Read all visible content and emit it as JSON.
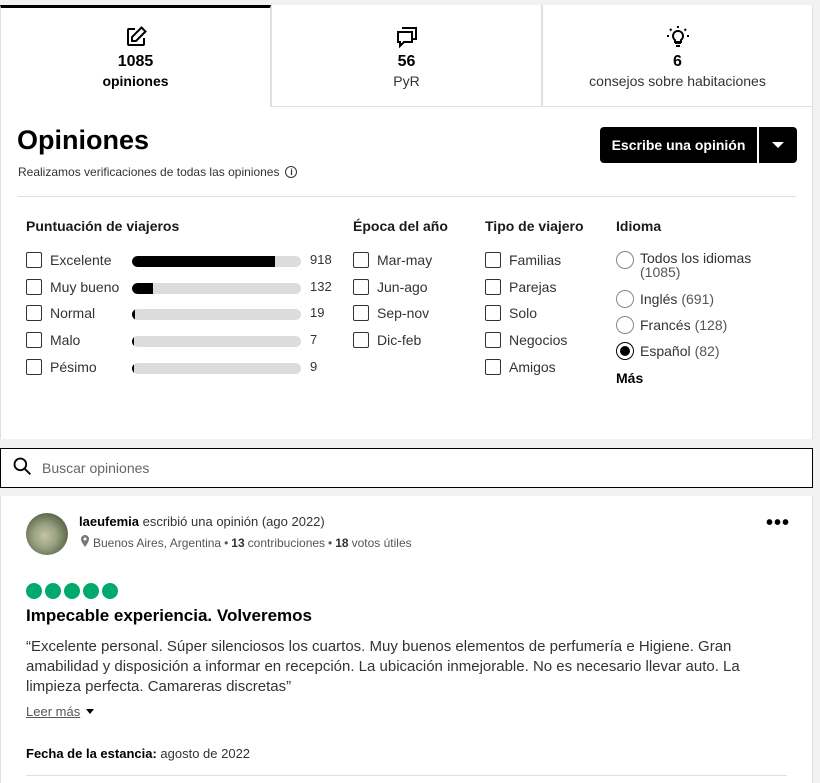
{
  "tabs": [
    {
      "count": "1085",
      "label": "opiniones",
      "icon": "pencil-icon"
    },
    {
      "count": "56",
      "label": "PyR",
      "icon": "chat-icon"
    },
    {
      "count": "6",
      "label": "consejos sobre habitaciones",
      "icon": "lightbulb-icon"
    }
  ],
  "reviews_panel": {
    "title": "Opiniones",
    "subtitle": "Realizamos verificaciones de todas las opiniones",
    "write_button": "Escribe una opinión"
  },
  "filters": {
    "rating": {
      "title": "Puntuación de viajeros",
      "items": [
        {
          "label": "Excelente",
          "count": "918",
          "fraction": 0.846
        },
        {
          "label": "Muy bueno",
          "count": "132",
          "fraction": 0.122
        },
        {
          "label": "Normal",
          "count": "19",
          "fraction": 0.018
        },
        {
          "label": "Malo",
          "count": "7",
          "fraction": 0.006
        },
        {
          "label": "Pésimo",
          "count": "9",
          "fraction": 0.008
        }
      ]
    },
    "season": {
      "title": "Época del año",
      "items": [
        "Mar-may",
        "Jun-ago",
        "Sep-nov",
        "Dic-feb"
      ]
    },
    "traveler": {
      "title": "Tipo de viajero",
      "items": [
        "Familias",
        "Parejas",
        "Solo",
        "Negocios",
        "Amigos"
      ]
    },
    "language": {
      "title": "Idioma",
      "items": [
        {
          "label": "Todos los idiomas",
          "count": "(1085)",
          "selected": false
        },
        {
          "label": "Inglés",
          "count": "(691)",
          "selected": false
        },
        {
          "label": "Francés",
          "count": "(128)",
          "selected": false
        },
        {
          "label": "Español",
          "count": "(82)",
          "selected": true
        }
      ],
      "more": "Más"
    }
  },
  "search": {
    "placeholder": "Buscar opiniones"
  },
  "review": {
    "author": "laeufemia",
    "action": "escribió una opinión (ago 2022)",
    "location": "Buenos Aires, Argentina",
    "contributions_count": "13",
    "contributions_label": "contribuciones",
    "votes_count": "18",
    "votes_label": "votos útiles",
    "rating": 5,
    "rating_color": "#00aa6c",
    "title": "Impecable experiencia. Volveremos",
    "body": "“Excelente personal. Súper silenciosos los cuartos. Muy buenos elementos de perfumería e Higiene. Gran amabilidad y disposición a informar en recepción. La ubicación inmejorable. No es necesario llevar auto. La limpieza perfecta. Camareras discretas”",
    "read_more": "Leer más",
    "stay_label": "Fecha de la estancia:",
    "stay_value": "agosto de 2022",
    "separator": "•"
  }
}
